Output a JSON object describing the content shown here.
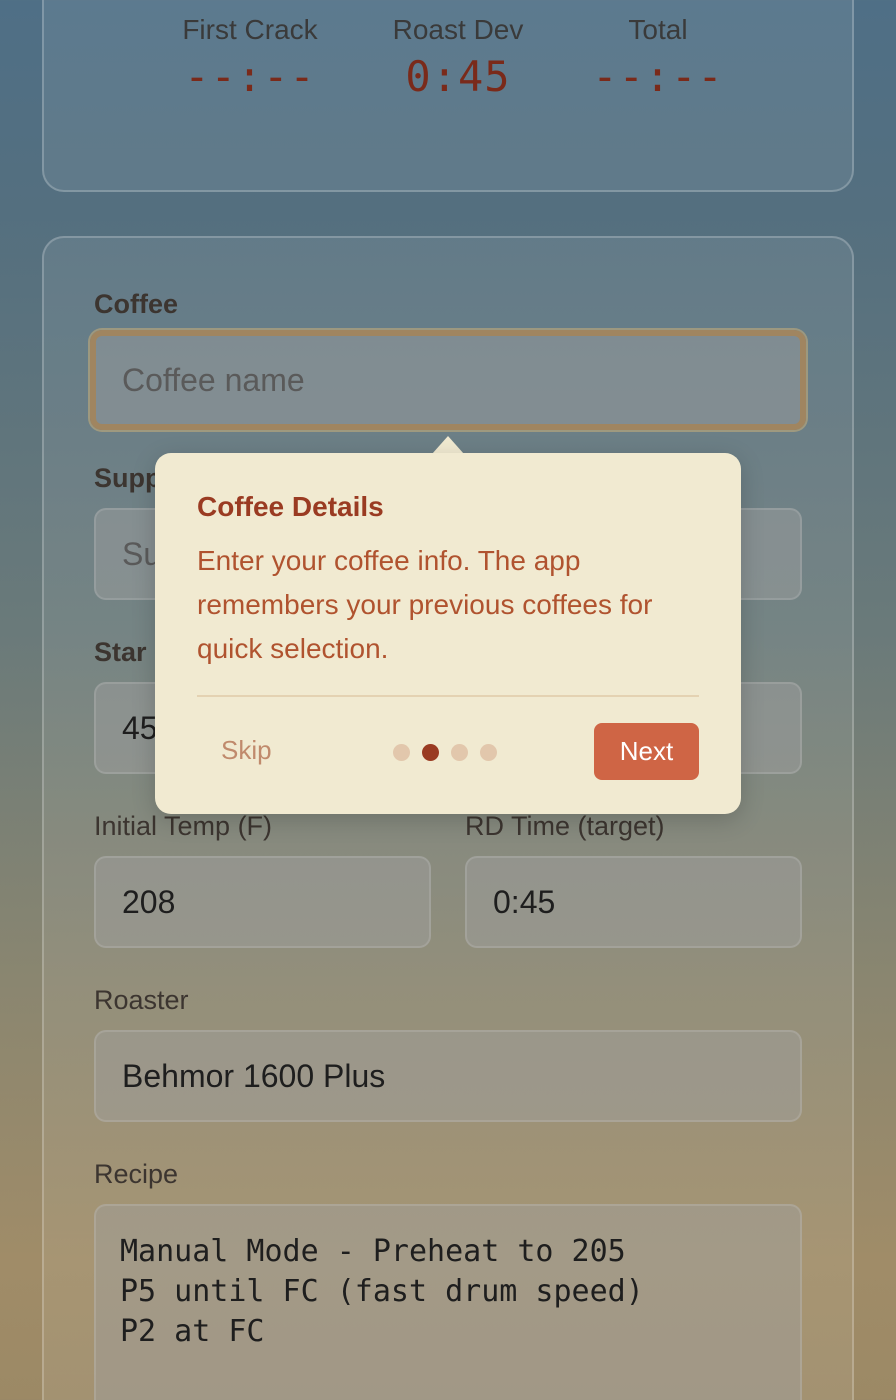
{
  "timers": {
    "first_crack": {
      "label": "First Crack",
      "value": "--:--"
    },
    "roast_dev": {
      "label": "Roast Dev",
      "value": "0:45"
    },
    "total": {
      "label": "Total",
      "value": "--:--"
    }
  },
  "form": {
    "coffee": {
      "label": "Coffee",
      "placeholder": "Coffee name"
    },
    "supplier": {
      "label": "Supp",
      "placeholder": "Su"
    },
    "start": {
      "label": "Star",
      "value": "45"
    },
    "initial_temp": {
      "label": "Initial Temp (F)",
      "value": "208"
    },
    "rd_time": {
      "label": "RD Time (target)",
      "value": "0:45"
    },
    "roaster": {
      "label": "Roaster",
      "value": "Behmor 1600 Plus"
    },
    "recipe": {
      "label": "Recipe",
      "value": "Manual Mode - Preheat to 205\nP5 until FC (fast drum speed)\nP2 at FC"
    }
  },
  "tooltip": {
    "title": "Coffee Details",
    "body": "Enter your coffee info. The app remembers your previous coffees for quick selection.",
    "skip_label": "Skip",
    "next_label": "Next",
    "step_total": 4,
    "step_current": 2
  },
  "colors": {
    "accent": "#cf6545",
    "title": "#9a3b22",
    "tooltip_bg": "#f1ead1"
  }
}
